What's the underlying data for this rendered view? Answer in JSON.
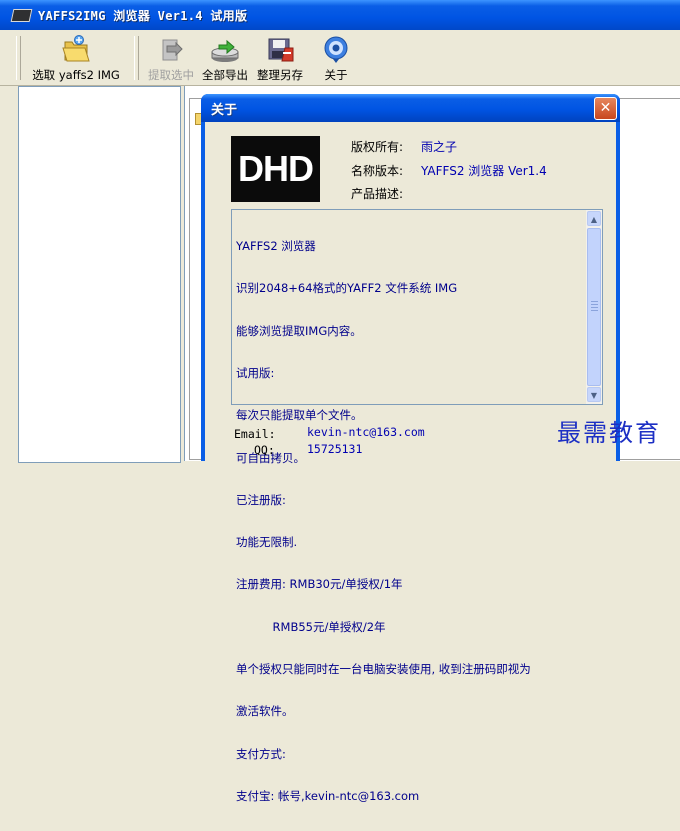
{
  "window": {
    "title": "YAFFS2IMG 浏览器 Ver1.4 试用版"
  },
  "toolbar": {
    "items": [
      {
        "label": "选取 yaffs2 IMG",
        "icon": "folder-open-icon",
        "enabled": true
      },
      {
        "label": "提取选中",
        "icon": "extract-icon",
        "enabled": false
      },
      {
        "label": "全部导出",
        "icon": "export-all-icon",
        "enabled": true
      },
      {
        "label": "整理另存",
        "icon": "save-as-icon",
        "enabled": true
      },
      {
        "label": "关于",
        "icon": "about-icon",
        "enabled": true
      }
    ]
  },
  "about_dialog": {
    "title": "关于",
    "close_symbol": "✕",
    "logo_text": "DHD",
    "copyright_label": "版权所有:",
    "copyright_value": "雨之子",
    "version_label": "名称版本:",
    "version_value": "YAFFS2 浏览器 Ver1.4",
    "description_label": "产品描述:",
    "description_lines": [
      "YAFFS2 浏览器",
      "识别2048+64格式的YAFF2 文件系统 IMG",
      "能够浏览提取IMG内容。",
      "试用版:",
      "每次只能提取单个文件。",
      "可自由拷贝。",
      "已注册版:",
      "功能无限制.",
      "注册费用: RMB30元/单授权/1年",
      "          RMB55元/单授权/2年",
      "单个授权只能同时在一台电脑安装使用, 收到注册码即视为",
      "激活软件。",
      "支付方式:",
      "支付宝: 帐号,kevin-ntc@163.com"
    ],
    "email_label": "Email:",
    "email_value": "kevin-ntc@163.com",
    "qq_label": "QQ:",
    "qq_value": "15725131"
  },
  "watermark": "最需教育",
  "colors": {
    "title_bar": "#0054e3",
    "dialog_face": "#ece9d8",
    "link_text": "#0000b0",
    "description_text": "#00008b",
    "watermark": "#1c2fc4"
  }
}
